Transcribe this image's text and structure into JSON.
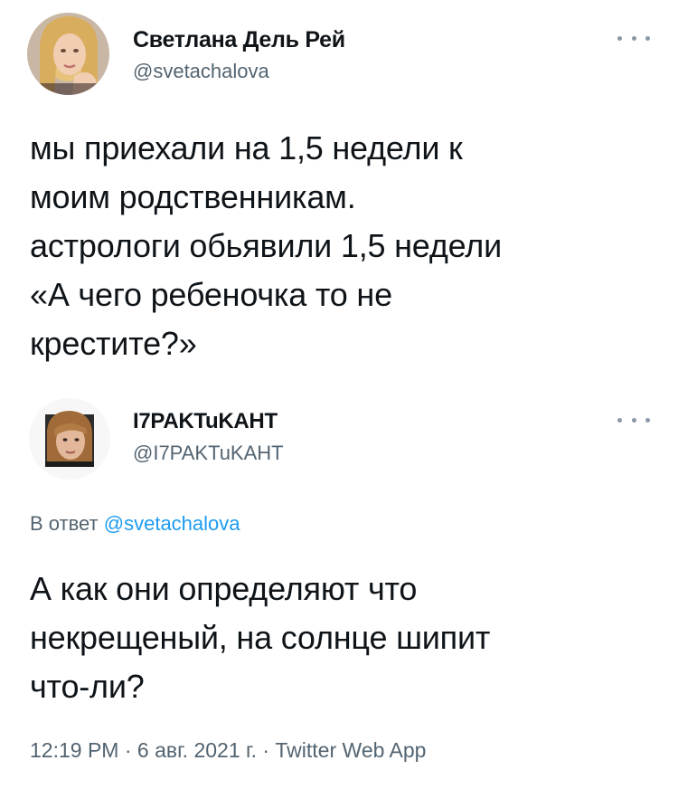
{
  "original_tweet": {
    "author_name": "Светлана Дель Рей",
    "author_handle": "@svetachalova",
    "avatar_icon": "user-avatar-photo",
    "more_icon": "more-horizontal-icon",
    "text_lines": [
      "мы приехали на 1,5 недели к",
      "моим родственникам.",
      "астрологи обьявили 1,5 недели",
      "«А чего ребеночка то не",
      "крестите?»"
    ]
  },
  "reply_tweet": {
    "author_name": "I7PAKTuKAHT",
    "author_handle": "@I7PAKTuKAHT",
    "avatar_icon": "user-avatar-photo",
    "more_icon": "more-horizontal-icon",
    "replying_to_prefix": "В ответ",
    "replying_to_handle": "@svetachalova",
    "text_lines": [
      "А как они определяют что",
      "некрещеный, на солнце шипит",
      "что-ли?"
    ],
    "timestamp": "12:19 PM · 6 авг. 2021 г. · Twitter Web App"
  },
  "colors": {
    "text": "#0f1419",
    "secondary": "#536471",
    "link": "#1d9bf0"
  }
}
